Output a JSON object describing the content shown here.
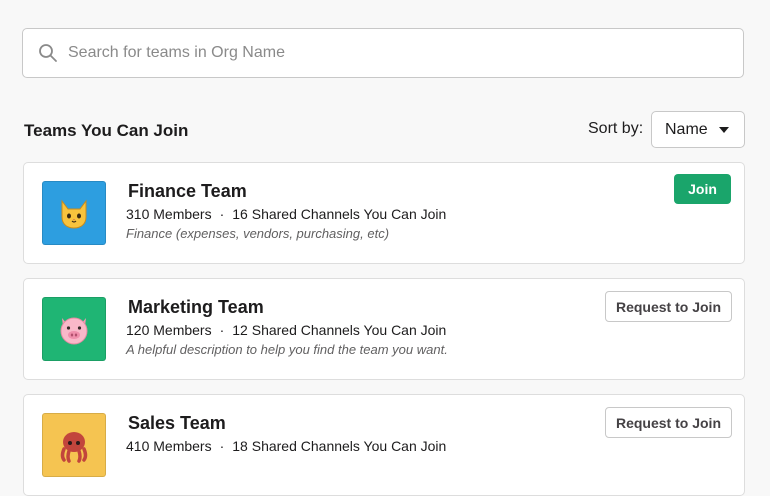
{
  "search": {
    "placeholder": "Search for teams in Org Name",
    "value": ""
  },
  "section": {
    "title": "Teams You Can Join",
    "sort_label": "Sort by:",
    "sort_value": "Name"
  },
  "colors": {
    "join_button": "#1aa56b",
    "finance_avatar": "#2d9ee0",
    "marketing_avatar": "#1fb574",
    "sales_avatar": "#f5c451"
  },
  "teams": [
    {
      "name": "Finance Team",
      "members": "310 Members",
      "channels": "16 Shared Channels You Can Join",
      "description": "Finance (expenses, vendors, purchasing, etc)",
      "action": "Join",
      "avatar_icon": "cat-face-icon"
    },
    {
      "name": "Marketing Team",
      "members": "120 Members",
      "channels": "12 Shared Channels You Can Join",
      "description": "A helpful description to help you find the team you want.",
      "action": "Request to Join",
      "avatar_icon": "pig-face-icon"
    },
    {
      "name": "Sales Team",
      "members": "410 Members",
      "channels": "18 Shared Channels You Can Join",
      "description": "",
      "action": "Request to Join",
      "avatar_icon": "octopus-icon"
    }
  ],
  "separator": "·"
}
